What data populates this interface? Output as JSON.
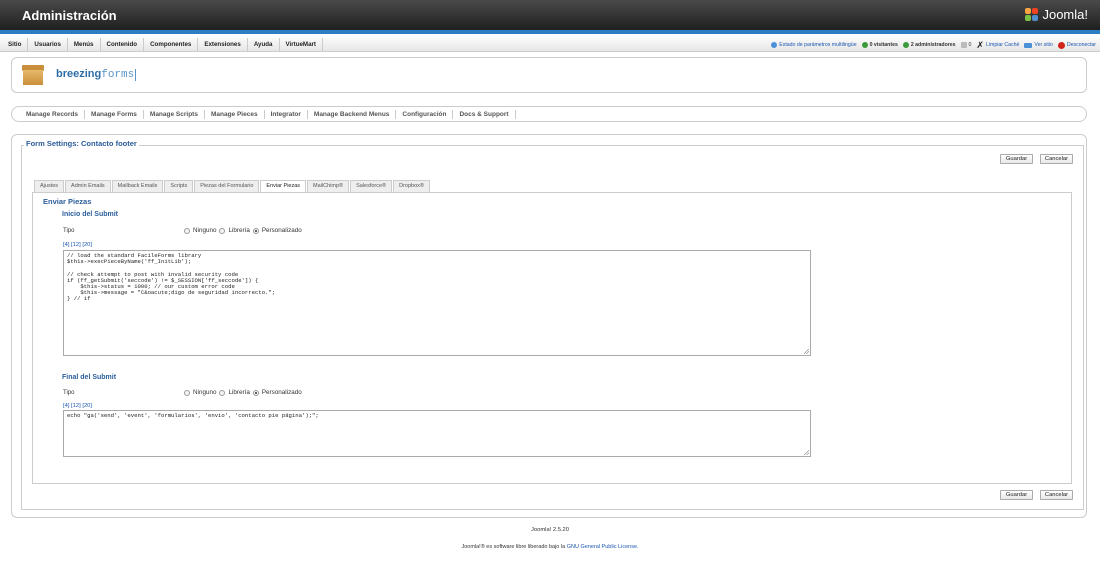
{
  "header": {
    "title": "Administración",
    "logo_text": "Joomla!"
  },
  "menu": {
    "items": [
      "Sitio",
      "Usuarios",
      "Menús",
      "Contenido",
      "Componentes",
      "Extensiones",
      "Ayuda",
      "VirtueMart"
    ]
  },
  "status": {
    "multilang": "Estado de parámetros multilingüe",
    "visitors": "0 visitantes",
    "admins": "2 administradores",
    "messages": "0",
    "clear_cache": "Limpiar Caché",
    "view_site": "Ver sitio",
    "logout": "Desconectar"
  },
  "brand": {
    "name_bold": "breezing",
    "name_light": "forms"
  },
  "toolnav": {
    "items": [
      "Manage Records",
      "Manage Forms",
      "Manage Scripts",
      "Manage Pieces",
      "Integrator",
      "Manage Backend Menus",
      "Configuración",
      "Docs & Support"
    ]
  },
  "form": {
    "legend": "Form Settings: Contacto footer",
    "save": "Guardar",
    "cancel": "Cancelar"
  },
  "tabs": {
    "items": [
      "Ajustes",
      "Admin Emails",
      "Mailback Emails",
      "Scripts",
      "Piezas del Formulario",
      "Enviar Piezas",
      "MailChimp®",
      "Salesforce®",
      "Dropbox®"
    ],
    "active_index": 5
  },
  "pieces": {
    "heading": "Enviar Piezas",
    "start": {
      "title": "Inicio del Submit",
      "type_label": "Tipo",
      "options": [
        "Ninguno",
        "Librería",
        "Personalizado"
      ],
      "selected": "Personalizado",
      "links": "[4] [12] [20]",
      "code": "// load the standard FacileForms library\n$this->execPieceByName('ff_InitLib');\n\n// check attempt to post with invalid security code\nif (ff_getSubmit('seccode') != $_SESSION['ff_seccode']) {\n    $this->status = 1000; // our custom error code\n    $this->message = \"C&oacute;digo de seguridad incorrecto.\";\n} // if"
    },
    "end": {
      "title": "Final del Submit",
      "type_label": "Tipo",
      "options": [
        "Ninguno",
        "Librería",
        "Personalizado"
      ],
      "selected": "Personalizado",
      "links": "[4] [12] [20]",
      "code": "echo \"ga('send', 'event', 'formularios', 'envio', 'contacto pie página');\";"
    }
  },
  "footer": {
    "version": "Joomla! 2.5.20",
    "license_prefix": "Joomla!® es software libre liberado bajo la",
    "license_link": "GNU General Public License."
  },
  "colors": {
    "accent": "#2b7ec1",
    "heading": "#2b5d9b",
    "link": "#1b57b1"
  }
}
